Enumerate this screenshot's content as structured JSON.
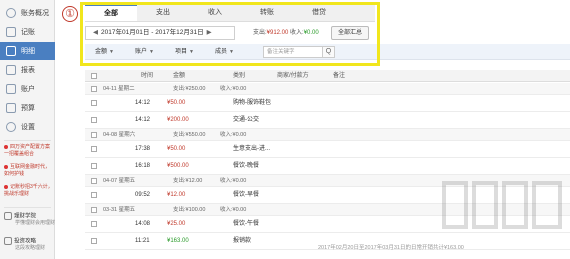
{
  "sidebar": {
    "items": [
      {
        "label": "账务概况",
        "icon": "overview-icon"
      },
      {
        "label": "记账",
        "icon": "edit-icon"
      },
      {
        "label": "明细",
        "icon": "detail-icon"
      },
      {
        "label": "报表",
        "icon": "report-icon"
      },
      {
        "label": "账户",
        "icon": "account-icon"
      },
      {
        "label": "预算",
        "icon": "budget-icon"
      },
      {
        "label": "设置",
        "icon": "gear-icon"
      }
    ],
    "promos": [
      "四万资产配置方案 一招覆盖组合",
      "互联网金融时代，如何护钱",
      "记账秒招3千六计，挑战乐理财"
    ],
    "bottom_links": [
      {
        "title": "理财学院",
        "sub": "学懂理财会用理财"
      },
      {
        "title": "投资攻略",
        "sub": "这段攻略理财"
      }
    ]
  },
  "annotation": {
    "number": "①"
  },
  "tabs": [
    "全部",
    "支出",
    "收入",
    "转账",
    "借贷"
  ],
  "date_range": {
    "text": "2017年01月01日 - 2017年12月31日",
    "prev": "◀",
    "next": "▶"
  },
  "summary": {
    "expense_label": "支出:",
    "expense": "¥912.00",
    "income_label": "收入:",
    "income": "¥0.00"
  },
  "summary_button": "全部汇总",
  "filters": [
    {
      "label": "金额"
    },
    {
      "label": "账户"
    },
    {
      "label": "项目"
    },
    {
      "label": "成员"
    }
  ],
  "search": {
    "placeholder": "备注关键字",
    "button": "Q"
  },
  "table": {
    "headers": [
      "时间",
      "金额",
      "类别",
      "商家/付款方",
      "备注"
    ],
    "rows": [
      {
        "type": "group",
        "date": "04-11 星期二",
        "summary": "支出:¥250.00",
        "summary2": "收入:¥0.00"
      },
      {
        "type": "item",
        "time": "14:12",
        "amount": "¥50.00",
        "kind": "exp",
        "category": "购物-服饰鞋包"
      },
      {
        "type": "item",
        "time": "14:12",
        "amount": "¥200.00",
        "kind": "exp",
        "category": "交通-公交"
      },
      {
        "type": "group",
        "date": "04-08 星期六",
        "summary": "支出:¥550.00",
        "summary2": "收入:¥0.00"
      },
      {
        "type": "item",
        "time": "17:38",
        "amount": "¥50.00",
        "kind": "exp",
        "category": "生意支出-进..."
      },
      {
        "type": "item",
        "time": "16:18",
        "amount": "¥500.00",
        "kind": "exp",
        "category": "餐饮-晚餐"
      },
      {
        "type": "group",
        "date": "04-07 星期五",
        "summary": "支出:¥12.00",
        "summary2": "收入:¥0.00"
      },
      {
        "type": "item",
        "time": "09:52",
        "amount": "¥12.00",
        "kind": "exp",
        "category": "餐饮-早餐"
      },
      {
        "type": "group",
        "date": "03-31 星期五",
        "summary": "支出:¥100.00",
        "summary2": "收入:¥0.00"
      },
      {
        "type": "item",
        "time": "14:08",
        "amount": "¥25.00",
        "kind": "exp",
        "category": "餐饮-午餐"
      },
      {
        "type": "item",
        "time": "11:21",
        "amount": "¥163.00",
        "kind": "inc",
        "category": "报销款"
      }
    ]
  },
  "footer": "2017年02月20日至2017年03月31日的日常开销共计¥163.00"
}
